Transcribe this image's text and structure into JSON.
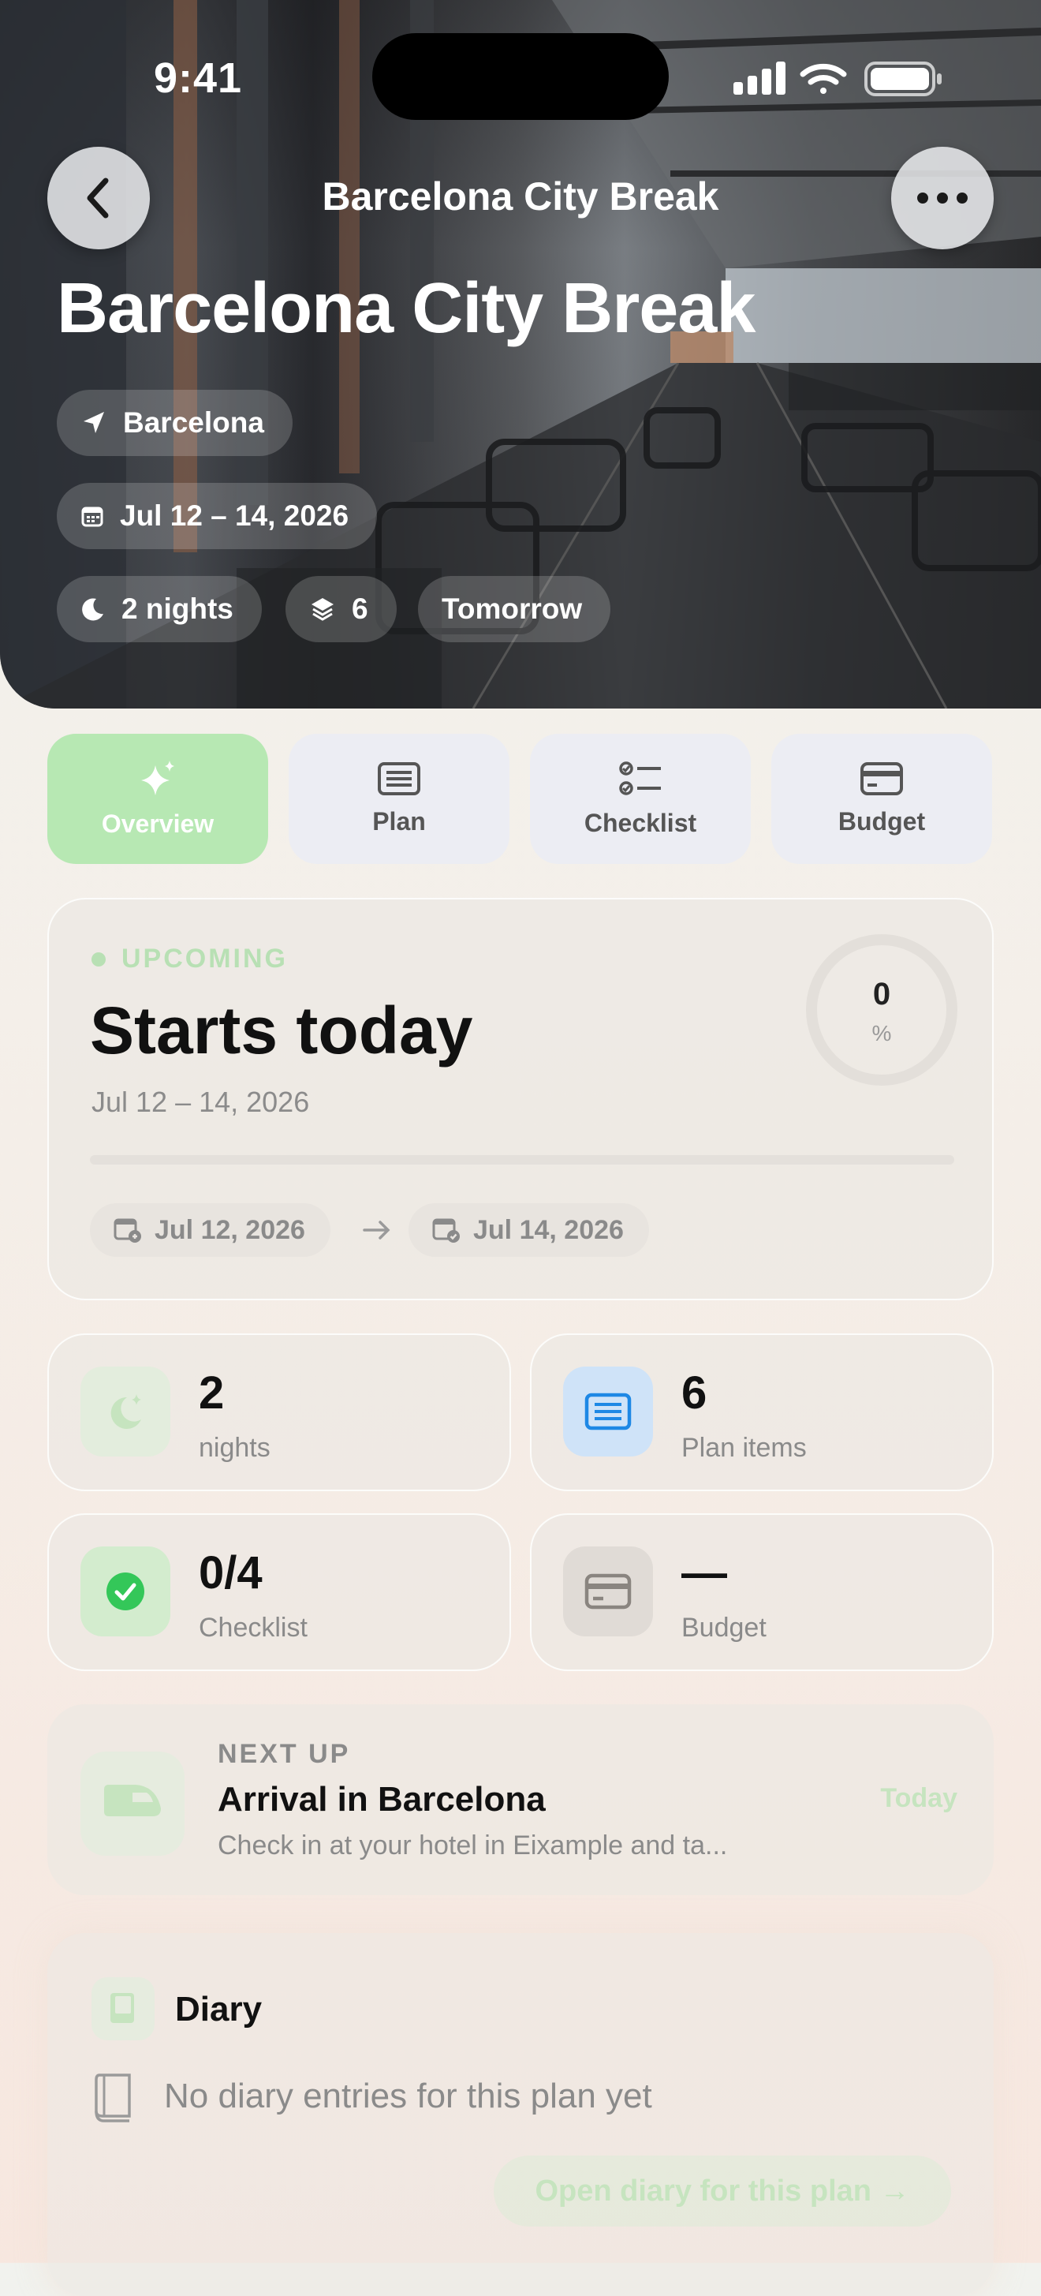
{
  "status_bar": {
    "time": "9:41"
  },
  "header": {
    "nav_title": "Barcelona City Break",
    "title": "Barcelona City Break",
    "back_icon": "chevron-left-icon",
    "more_icon": "ellipsis-icon"
  },
  "chips": {
    "location": "Barcelona",
    "dates": "Jul 12 – 14, 2026",
    "nights": "2 nights",
    "items": "6",
    "when": "Tomorrow"
  },
  "tabs": [
    {
      "label": "Overview",
      "icon": "sparkles-icon",
      "active": true
    },
    {
      "label": "Plan",
      "icon": "list-icon",
      "active": false
    },
    {
      "label": "Checklist",
      "icon": "checklist-icon",
      "active": false
    },
    {
      "label": "Budget",
      "icon": "card-icon",
      "active": false
    }
  ],
  "status_card": {
    "badge": "UPCOMING",
    "headline": "Starts today",
    "date_range": "Jul 12 – 14, 2026",
    "progress_value": "0",
    "progress_unit": "%",
    "progress": 0,
    "start_date": "Jul 12, 2026",
    "end_date": "Jul 14, 2026"
  },
  "stats": [
    {
      "value": "2",
      "label": "nights",
      "icon": "moon-stars-icon",
      "color": "#dcefd8"
    },
    {
      "value": "6",
      "label": "Plan items",
      "icon": "list-icon",
      "color": "#cfe3f8"
    },
    {
      "value": "0/4",
      "label": "Checklist",
      "icon": "checkmark-circle-icon",
      "color": "#d3ecce"
    },
    {
      "value": "—",
      "label": "Budget",
      "icon": "card-icon",
      "color": "#e0dbd6"
    }
  ],
  "next_up": {
    "eyebrow": "NEXT UP",
    "title": "Arrival in Barcelona",
    "subtitle": "Check in at your hotel in Eixample and ta...",
    "when": "Today",
    "icon": "train-icon"
  },
  "diary": {
    "title": "Diary",
    "empty_text": "No diary entries for this plan yet",
    "open_button": "Open diary for this plan →"
  },
  "colors": {
    "accent": "#b7e8b3",
    "green": "#34c759",
    "blue": "#1e88e5"
  }
}
